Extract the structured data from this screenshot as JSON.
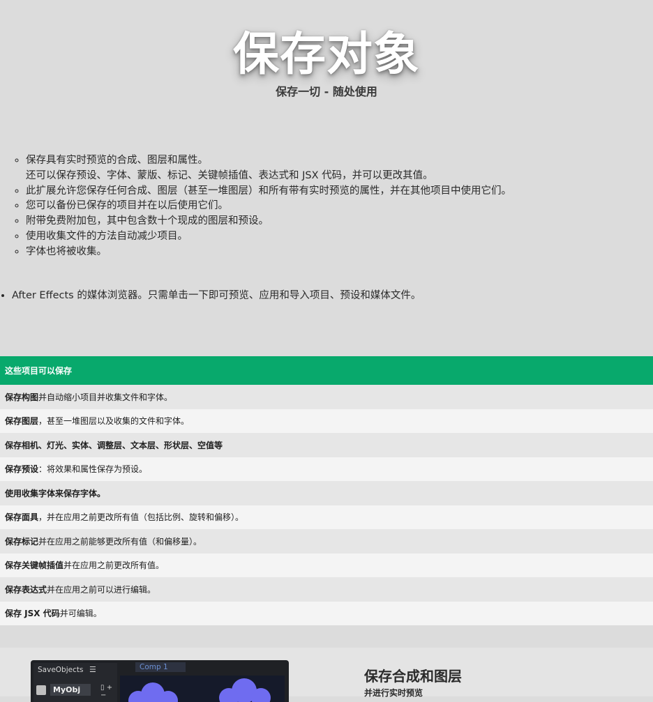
{
  "hero": {
    "title": "保存对象",
    "subtitle": "保存一切 - 随处使用"
  },
  "sub_list": [
    {
      "line1": "保存具有实时预览的合成、图层和属性。",
      "line2": "还可以保存预设、字体、蒙版、标记、关键帧插值、表达式和 JSX 代码，并可以更改其值。"
    },
    {
      "line1": "此扩展允许您保存任何合成、图层（甚至一堆图层）和所有带有实时预览的属性，并在其他项目中使用它们。",
      "line2": ""
    },
    {
      "line1": "您可以备份已保存的项目并在以后使用它们。",
      "line2": ""
    },
    {
      "line1": "附带免费附加包，其中包含数十个现成的图层和预设。",
      "line2": ""
    },
    {
      "line1": "使用收集文件的方法自动减少项目。",
      "line2": ""
    },
    {
      "line1": "字体也将被收集。",
      "line2": ""
    }
  ],
  "main_list": [
    "After Effects 的媒体浏览器。只需单击一下即可预览、应用和导入项目、预设和媒体文件。"
  ],
  "table": {
    "header": "这些项目可以保存",
    "rows": [
      {
        "bold": "保存构图",
        "rest": " 并自动缩小项目并收集文件和字体。"
      },
      {
        "bold": "保存图层",
        "rest": "，甚至一堆图层以及收集的文件和字体。"
      },
      {
        "bold": "保存相机、灯光、实体、调整层、文本层、形状层、空值等",
        "rest": ""
      },
      {
        "bold": "保存预设",
        "rest": "：将效果和属性保存为预设。"
      },
      {
        "bold": "使用收集字体来保存字体。",
        "rest": ""
      },
      {
        "bold": "保存面具",
        "rest": "，并在应用之前更改所有值（包括比例、旋转和偏移）。"
      },
      {
        "bold": "保存标记",
        "rest": "并在应用之前能够更改所有值（和偏移量）。"
      },
      {
        "bold": "保存关键帧插值",
        "rest": "并在应用之前更改所有值。"
      },
      {
        "bold": "保存表达式",
        "rest": "并在应用之前可以进行编辑。"
      },
      {
        "bold": "保存 JSX 代码",
        "rest": "并可编辑。"
      }
    ]
  },
  "panel": {
    "title": "SaveObjects",
    "menu_icon": "menu-icon",
    "object_name": "MyObj",
    "comp_tab": "Comp 1",
    "plus": "+",
    "minus": "−"
  },
  "promo": {
    "title": "保存合成和图层",
    "subtitle": "并进行实时预览"
  },
  "colors": {
    "accent": "#08a96c",
    "background": "#dcdcdc",
    "panel": "#1f2125",
    "cloud": "#6f6cf0"
  }
}
